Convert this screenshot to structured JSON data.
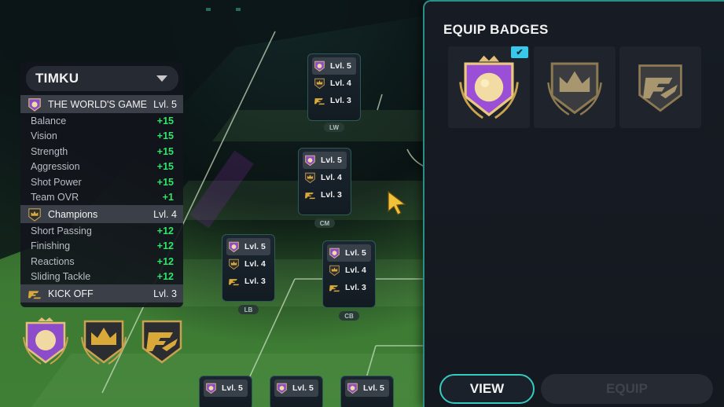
{
  "stats_panel": {
    "player_name": "TIMKU",
    "badges": [
      {
        "icon": "worlds-game-badge-icon",
        "title": "THE WORLD'S GAME",
        "level": "Lvl. 5",
        "stats": [
          {
            "name": "Balance",
            "value": "+15"
          },
          {
            "name": "Vision",
            "value": "+15"
          },
          {
            "name": "Strength",
            "value": "+15"
          },
          {
            "name": "Aggression",
            "value": "+15"
          },
          {
            "name": "Shot Power",
            "value": "+15"
          },
          {
            "name": "Team OVR",
            "value": "+1"
          }
        ]
      },
      {
        "icon": "champions-crown-badge-icon",
        "title": "Champions",
        "level": "Lvl. 4",
        "stats": [
          {
            "name": "Short Passing",
            "value": "+12"
          },
          {
            "name": "Finishing",
            "value": "+12"
          },
          {
            "name": "Reactions",
            "value": "+12"
          },
          {
            "name": "Sliding Tackle",
            "value": "+12"
          }
        ]
      },
      {
        "icon": "kick-off-fc-badge-icon",
        "title": "KICK OFF",
        "level": "Lvl. 3",
        "stats": []
      }
    ]
  },
  "formation": {
    "cards": [
      {
        "position": "LW",
        "levels": [
          "Lvl. 5",
          "Lvl. 4",
          "Lvl. 3"
        ]
      },
      {
        "position": "CM",
        "levels": [
          "Lvl. 5",
          "Lvl. 4",
          "Lvl. 3"
        ]
      },
      {
        "position": "LB",
        "levels": [
          "Lvl. 5",
          "Lvl. 4",
          "Lvl. 3"
        ]
      },
      {
        "position": "CB",
        "levels": [
          "Lvl. 5",
          "Lvl. 4",
          "Lvl. 3"
        ]
      },
      {
        "position": "",
        "levels": [
          "Lvl. 5"
        ]
      },
      {
        "position": "",
        "levels": [
          "Lvl. 5"
        ]
      },
      {
        "position": "",
        "levels": [
          "Lvl. 5"
        ]
      }
    ]
  },
  "equip_panel": {
    "title": "EQUIP BADGES",
    "selected_index": 0,
    "check_glyph": "✔",
    "view_label": "VIEW",
    "equip_label": "EQUIP"
  },
  "colors": {
    "accent_teal": "#36c9c0",
    "stat_green": "#2ee66a",
    "check_blue": "#38c8ea",
    "badge_purple": "#9b4fd6",
    "badge_gold": "#d9a93a"
  }
}
